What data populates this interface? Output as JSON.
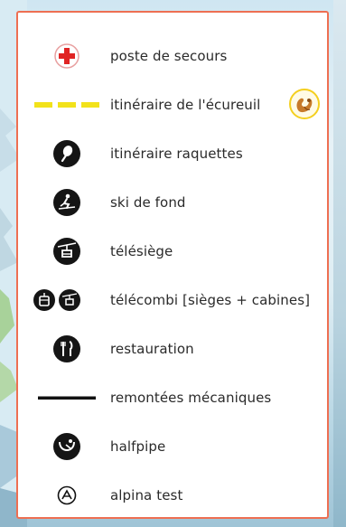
{
  "legend": {
    "items": [
      {
        "label": "poste de secours",
        "icon": "first-aid-icon"
      },
      {
        "label": "itinéraire de l'écureuil",
        "icon": "squirrel-trail-line",
        "color": "#f2e21a",
        "badge_icon": "squirrel-icon"
      },
      {
        "label": "itinéraire raquettes",
        "icon": "snowshoe-icon"
      },
      {
        "label": "ski de fond",
        "icon": "cross-country-ski-icon"
      },
      {
        "label": "télésiège",
        "icon": "chairlift-icon"
      },
      {
        "label": "télécombi [sièges + cabines]",
        "icon": "telemix-icon"
      },
      {
        "label": "restauration",
        "icon": "restaurant-icon"
      },
      {
        "label": "remontées mécaniques",
        "icon": "lift-line",
        "color": "#111111"
      },
      {
        "label": "halfpipe",
        "icon": "halfpipe-icon"
      },
      {
        "label": "alpina test",
        "icon": "alpina-test-icon"
      }
    ]
  },
  "colors": {
    "border": "#ee6f52",
    "first_aid": "#e02424",
    "squirrel_line": "#f2e21a"
  }
}
